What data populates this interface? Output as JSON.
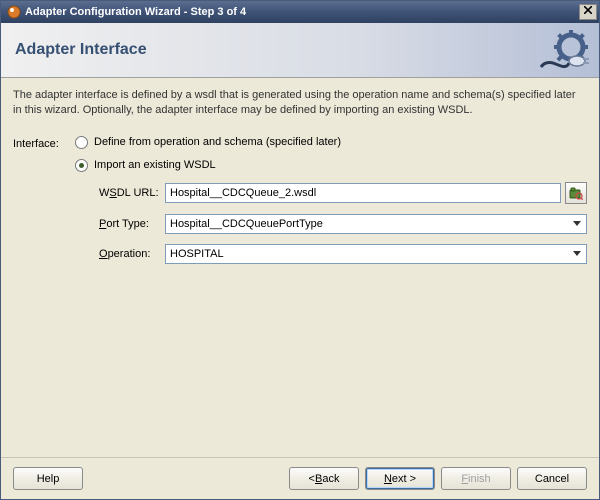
{
  "window": {
    "title": "Adapter Configuration Wizard - Step 3 of 4"
  },
  "header": {
    "title": "Adapter Interface"
  },
  "description": "The adapter interface is defined by a wsdl that is generated using the operation name and schema(s) specified later in this wizard.  Optionally, the adapter interface may be defined by importing an existing WSDL.",
  "form": {
    "interface_label": "Interface:",
    "radio_define": "Define from operation and schema (specified later)",
    "radio_import": "Import an existing WSDL",
    "wsdl_label_pre": "W",
    "wsdl_label_ul": "S",
    "wsdl_label_post": "DL URL:",
    "wsdl_value": "Hospital__CDCQueue_2.wsdl",
    "porttype_label_ul": "P",
    "porttype_label_post": "ort Type:",
    "porttype_value": "Hospital__CDCQueuePortType",
    "operation_label_ul": "O",
    "operation_label_post": "peration:",
    "operation_value": "HOSPITAL"
  },
  "buttons": {
    "help": "Help",
    "back_prefix": "< ",
    "back_ul": "B",
    "back_post": "ack",
    "next_ul": "N",
    "next_post": "ext >",
    "finish_ul": "F",
    "finish_post": "inish",
    "cancel": "Cancel"
  }
}
